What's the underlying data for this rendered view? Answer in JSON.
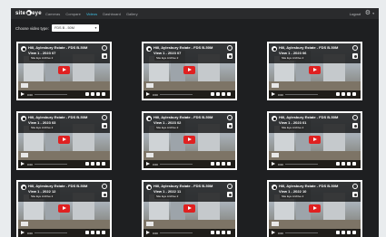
{
  "app": {
    "brand": "site eye"
  },
  "nav": {
    "items": [
      "Cameras",
      "Compare",
      "Videos",
      "Dashboard",
      "Gallery"
    ],
    "active": "Videos"
  },
  "header": {
    "logout": "Logout"
  },
  "filter": {
    "label": "Choose video type:",
    "selected": "FDS B - 50M"
  },
  "cards": [
    {
      "title": "Hill, Aylesbury Estate - FDS B-50M",
      "subtitle": "View 1 - 2023 07",
      "tag": "Site Eye Archive 2",
      "time": "0:00"
    },
    {
      "title": "Hill, Aylesbury Estate - FDS B-50M",
      "subtitle": "View 1 - 2023 07",
      "tag": "Site Eye Archive 2",
      "time": "0:00"
    },
    {
      "title": "Hill, Aylesbury Estate - FDS B-50M",
      "subtitle": "View 1 - 2023 06",
      "tag": "Site Eye Archive 2",
      "time": "0:00"
    },
    {
      "title": "Hill, Aylesbury Estate - FDS B-50M",
      "subtitle": "View 1 - 2023 03",
      "tag": "Site Eye Archive 2",
      "time": "0:00"
    },
    {
      "title": "Hill, Aylesbury Estate - FDS B-50M",
      "subtitle": "View 1 - 2023 02",
      "tag": "Site Eye Archive 2",
      "time": "0:00"
    },
    {
      "title": "Hill, Aylesbury Estate - FDS B-50M",
      "subtitle": "View 1 - 2023 01",
      "tag": "Site Eye Archive 2",
      "time": "0:00"
    },
    {
      "title": "Hill, Aylesbury Estate - FDS B-50M",
      "subtitle": "View 1 - 2022 12",
      "tag": "Site Eye Archive 2",
      "time": "0:00"
    },
    {
      "title": "Hill, Aylesbury Estate - FDS B-50M",
      "subtitle": "View 1 - 2022 11",
      "tag": "Site Eye Archive 2",
      "time": "0:00"
    },
    {
      "title": "Hill, Aylesbury Estate - FDS B-50M",
      "subtitle": "View 1 - 2022 10",
      "tag": "Site Eye Archive 2",
      "time": "0:00"
    }
  ],
  "icons": {
    "settings": "gear-icon",
    "play": "play-icon",
    "share": "share-icon",
    "watch_later": "clock-icon",
    "side": "feedback-tab-icon"
  },
  "colors": {
    "accent": "#3fc1e6",
    "play": "#e02020",
    "background": "#1e1f21"
  }
}
